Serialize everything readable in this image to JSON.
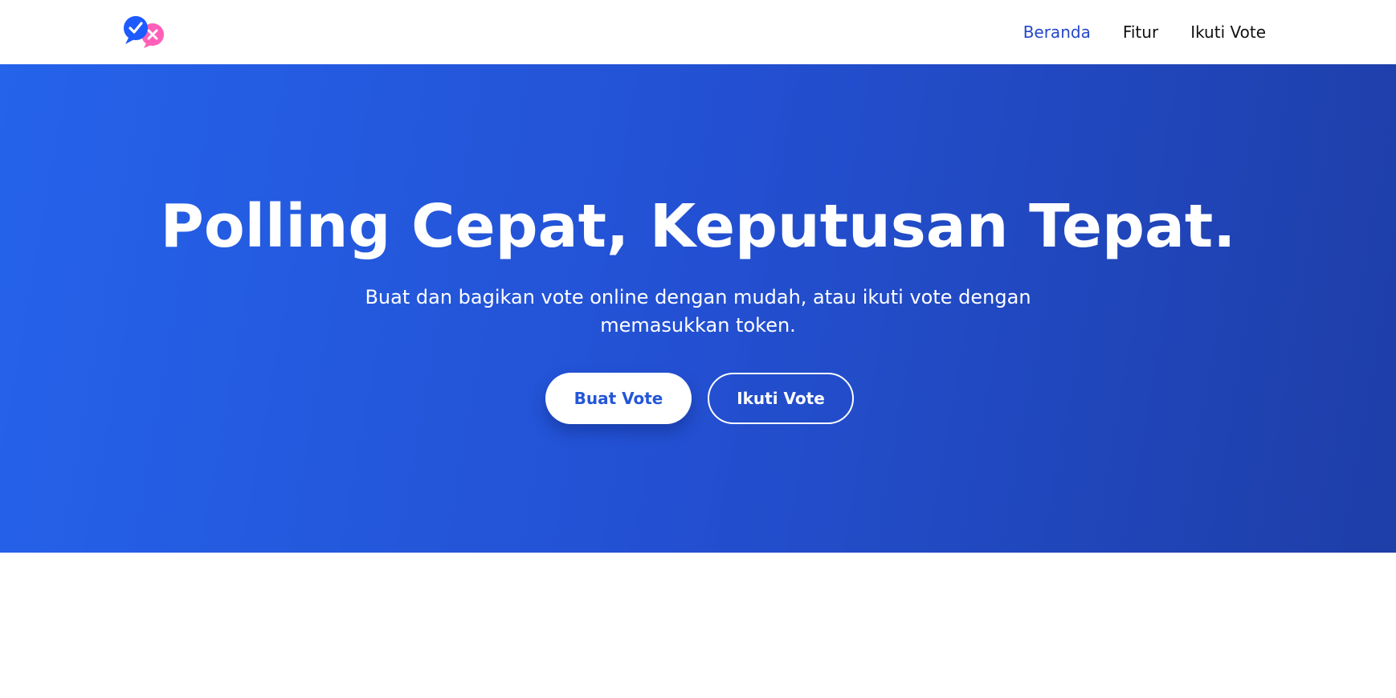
{
  "brand": {
    "logo_icon": "vote-chat-bubbles-icon",
    "colors": {
      "check_bubble": "#1d5bff",
      "cross_bubble": "#ff5fb8"
    }
  },
  "nav": {
    "items": [
      {
        "label": "Beranda",
        "active": true
      },
      {
        "label": "Fitur",
        "active": false
      },
      {
        "label": "Ikuti Vote",
        "active": false
      }
    ],
    "active_color": "#2547c9"
  },
  "hero": {
    "title": "Polling Cepat, Keputusan Tepat.",
    "subtitle": "Buat dan bagikan vote online dengan mudah, atau ikuti vote dengan memasukkan token.",
    "primary_button": "Buat Vote",
    "secondary_button": "Ikuti Vote",
    "gradient_colors": [
      "#2563eb",
      "#1e3ea8"
    ]
  }
}
